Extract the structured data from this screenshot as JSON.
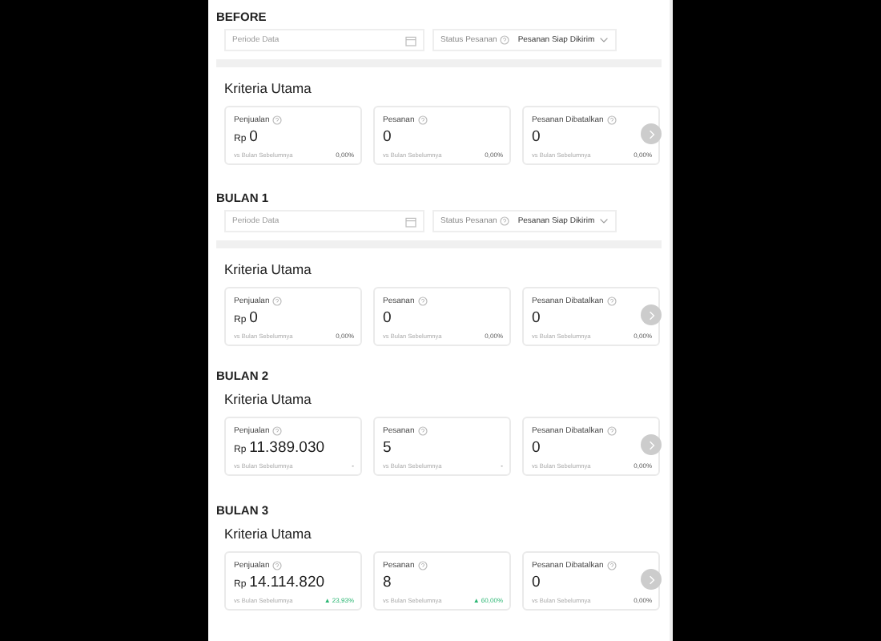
{
  "sections": [
    {
      "title": "BEFORE",
      "filters": {
        "period_placeholder": "Periode Data",
        "status_label": "Status Pesanan",
        "status_value": "Pesanan Siap Dikirim"
      },
      "heading": "Kriteria Utama",
      "cards": [
        {
          "label": "Penjualan",
          "prefix": "Rp",
          "value": "0",
          "comparison": "vs Bulan Sebelumnya",
          "change": "0,00%",
          "kind": "flat"
        },
        {
          "label": "Pesanan",
          "value": "0",
          "comparison": "vs Bulan Sebelumnya",
          "change": "0,00%",
          "kind": "flat"
        },
        {
          "label": "Pesanan Dibatalkan",
          "value": "0",
          "comparison": "vs Bulan Sebelumnya",
          "change": "0,00%",
          "kind": "flat"
        }
      ]
    },
    {
      "title": "BULAN 1",
      "filters": {
        "period_placeholder": "Periode Data",
        "status_label": "Status Pesanan",
        "status_value": "Pesanan Siap Dikirim"
      },
      "heading": "Kriteria Utama",
      "cards": [
        {
          "label": "Penjualan",
          "prefix": "Rp",
          "value": "0",
          "comparison": "vs Bulan Sebelumnya",
          "change": "0,00%",
          "kind": "flat"
        },
        {
          "label": "Pesanan",
          "value": "0",
          "comparison": "vs Bulan Sebelumnya",
          "change": "0,00%",
          "kind": "flat"
        },
        {
          "label": "Pesanan Dibatalkan",
          "value": "0",
          "comparison": "vs Bulan Sebelumnya",
          "change": "0,00%",
          "kind": "flat"
        }
      ]
    },
    {
      "title": "BULAN 2",
      "heading": "Kriteria Utama",
      "cards": [
        {
          "label": "Penjualan",
          "prefix": "Rp",
          "value": "11.389.030",
          "comparison": "vs Bulan Sebelumnya",
          "change": "-",
          "kind": "flat"
        },
        {
          "label": "Pesanan",
          "value": "5",
          "comparison": "vs Bulan Sebelumnya",
          "change": "-",
          "kind": "flat"
        },
        {
          "label": "Pesanan Dibatalkan",
          "value": "0",
          "comparison": "vs Bulan Sebelumnya",
          "change": "0,00%",
          "kind": "flat"
        }
      ]
    },
    {
      "title": "BULAN 3",
      "heading": "Kriteria Utama",
      "cards": [
        {
          "label": "Penjualan",
          "prefix": "Rp",
          "value": "14.114.820",
          "comparison": "vs Bulan Sebelumnya",
          "change": "▲ 23,93%",
          "kind": "up"
        },
        {
          "label": "Pesanan",
          "value": "8",
          "comparison": "vs Bulan Sebelumnya",
          "change": "▲ 60,00%",
          "kind": "up"
        },
        {
          "label": "Pesanan Dibatalkan",
          "value": "0",
          "comparison": "vs Bulan Sebelumnya",
          "change": "0,00%",
          "kind": "flat"
        }
      ]
    }
  ]
}
